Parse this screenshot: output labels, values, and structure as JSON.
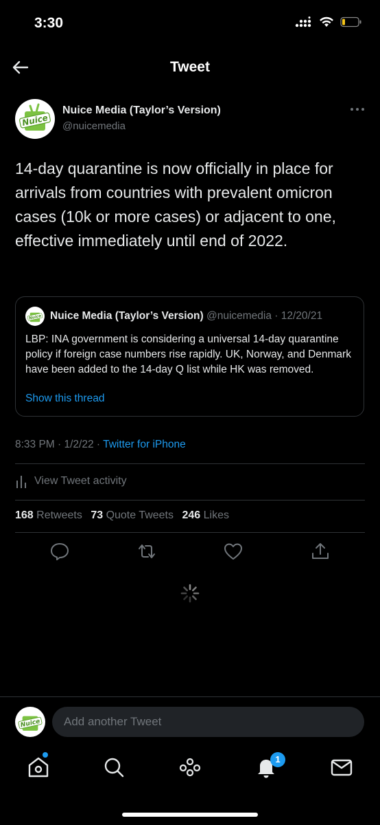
{
  "status_bar": {
    "time": "3:30"
  },
  "header": {
    "title": "Tweet"
  },
  "author": {
    "name": "Nuice Media (Taylor’s Version)",
    "handle": "@nuicemedia",
    "avatar_text": "Nuice"
  },
  "tweet": {
    "text": "14-day quarantine is now officially in place for arrivals from countries with prevalent omicron cases (10k or more cases) or adjacent to one, effective immediately until end of 2022."
  },
  "quote": {
    "name": "Nuice Media (Taylor’s Version)",
    "meta": "@nuicemedia · 12/20/21",
    "text": "LBP: INA government is considering a universal 14-day quarantine policy if foreign case numbers rise rapidly. UK, Norway, and Denmark have been added to the 14-day Q list while HK was removed.",
    "show_thread": "Show this thread"
  },
  "meta": {
    "timestamp": "8:33 PM · 1/2/22 · ",
    "source": "Twitter for iPhone"
  },
  "activity": {
    "label": "View Tweet activity"
  },
  "stats": {
    "retweets": "168",
    "retweets_label": "Retweets",
    "quotes": "73",
    "quotes_label": "Quote Tweets",
    "likes": "246",
    "likes_label": "Likes"
  },
  "reply": {
    "placeholder": "Add another Tweet"
  },
  "tabs": {
    "notifications_badge": "1"
  },
  "colors": {
    "accent": "#1d9bf0",
    "background": "#000000",
    "muted": "#71767b",
    "divider": "#2f3336"
  },
  "icons": [
    "back-arrow-icon",
    "more-icon",
    "reply-icon",
    "retweet-icon",
    "like-icon",
    "share-icon",
    "home-icon",
    "search-icon",
    "spaces-icon",
    "bell-icon",
    "mail-icon",
    "activity-icon",
    "loading-spinner-icon"
  ]
}
